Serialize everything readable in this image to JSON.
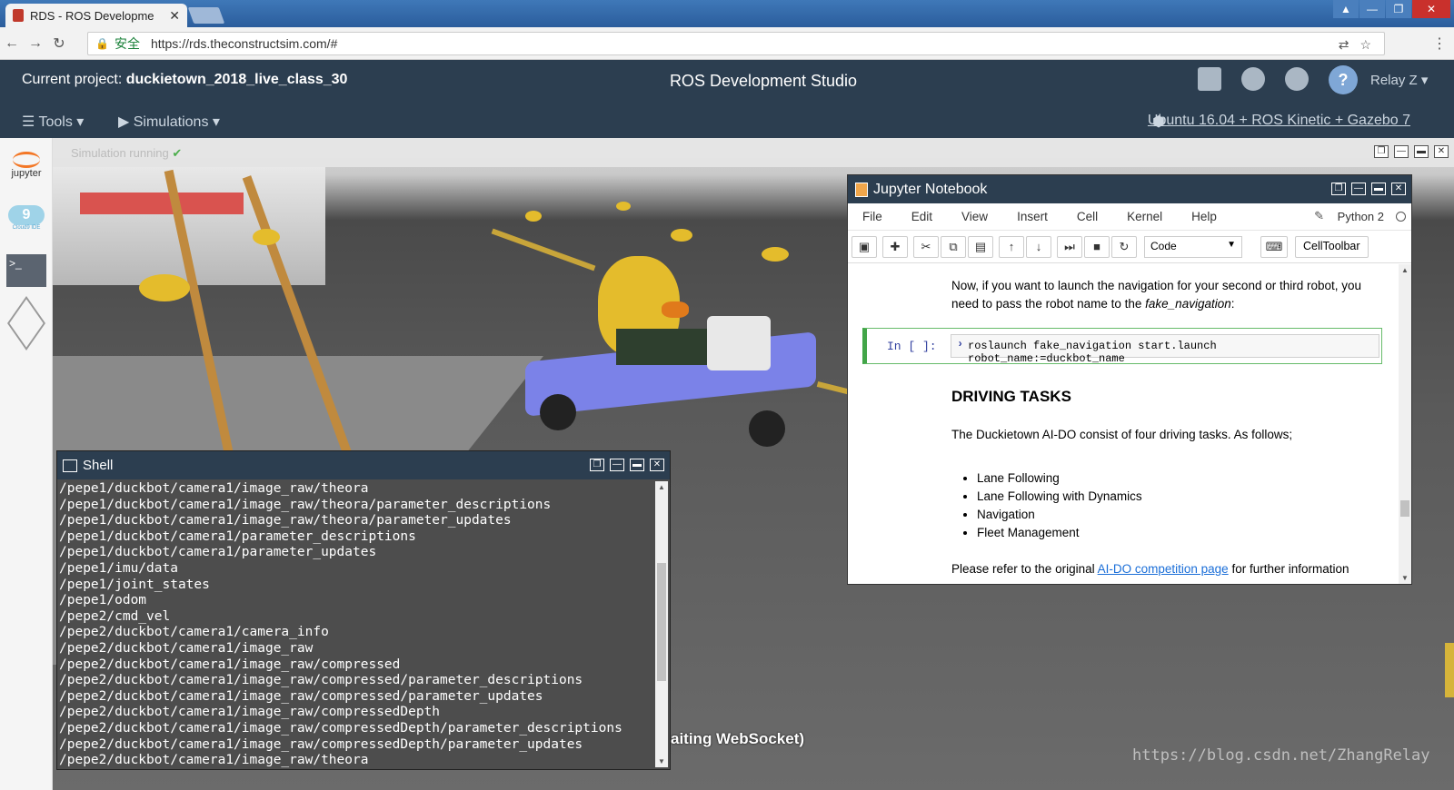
{
  "browser": {
    "tab_title": "RDS - ROS Developme",
    "secure_label": "安全",
    "url": "https://rds.theconstructsim.com/#"
  },
  "header": {
    "project_label": "Current project:",
    "project_name": "duckietown_2018_live_class_30",
    "app_title": "ROS Development Studio",
    "help_glyph": "?",
    "user_name": "Relay Z ▾"
  },
  "menu": {
    "tools": "☰ Tools ▾",
    "simulations": "▶ Simulations ▾",
    "distro": "Ubuntu 16.04 + ROS Kinetic + Gazebo 7"
  },
  "rail": {
    "jupyter": "jupyter",
    "cloud9_num": "9",
    "cloud9_label": "Cloud9 IDE",
    "shell_glyph": ">_"
  },
  "sim": {
    "status": "Simulation running",
    "status_check": "✔",
    "websocket_text": "aiting WebSocket)",
    "watermark": "https://blog.csdn.net/ZhangRelay"
  },
  "jupyter": {
    "title": "Jupyter Notebook",
    "menus": [
      "File",
      "Edit",
      "View",
      "Insert",
      "Cell",
      "Kernel",
      "Help"
    ],
    "kernel": "Python 2",
    "cell_type": "Code",
    "celltoolbar": "CellToolbar",
    "para1_a": "Now, if you want to launch the navigation for your second or third robot, you need to pass the robot name to the ",
    "para1_em": "fake_navigation",
    "para1_b": ":",
    "prompt": "In  [  ]:",
    "code": "roslaunch fake_navigation start.launch robot_name:=duckbot_name",
    "heading": "DRIVING TASKS",
    "para2": "The Duckietown AI-DO consist of four driving tasks. As follows;",
    "tasks": [
      "Lane Following",
      "Lane Following with Dynamics",
      "Navigation",
      "Fleet Management"
    ],
    "para3_a": "Please refer to the original ",
    "para3_link": "AI-DO competition page",
    "para3_b": " for further information"
  },
  "shell": {
    "title": "Shell",
    "lines": [
      "/pepe1/duckbot/camera1/image_raw/theora",
      "/pepe1/duckbot/camera1/image_raw/theora/parameter_descriptions",
      "/pepe1/duckbot/camera1/image_raw/theora/parameter_updates",
      "/pepe1/duckbot/camera1/parameter_descriptions",
      "/pepe1/duckbot/camera1/parameter_updates",
      "/pepe1/imu/data",
      "/pepe1/joint_states",
      "/pepe1/odom",
      "/pepe2/cmd_vel",
      "/pepe2/duckbot/camera1/camera_info",
      "/pepe2/duckbot/camera1/image_raw",
      "/pepe2/duckbot/camera1/image_raw/compressed",
      "/pepe2/duckbot/camera1/image_raw/compressed/parameter_descriptions",
      "/pepe2/duckbot/camera1/image_raw/compressed/parameter_updates",
      "/pepe2/duckbot/camera1/image_raw/compressedDepth",
      "/pepe2/duckbot/camera1/image_raw/compressedDepth/parameter_descriptions",
      "/pepe2/duckbot/camera1/image_raw/compressedDepth/parameter_updates",
      "/pepe2/duckbot/camera1/image_raw/theora"
    ]
  },
  "colors": {
    "header_bg": "#2c3e50",
    "accent_green": "#42a548",
    "link_blue": "#1a6ed8",
    "duck_yellow": "#e4bc2c",
    "robot_blue": "#7b82e8"
  }
}
